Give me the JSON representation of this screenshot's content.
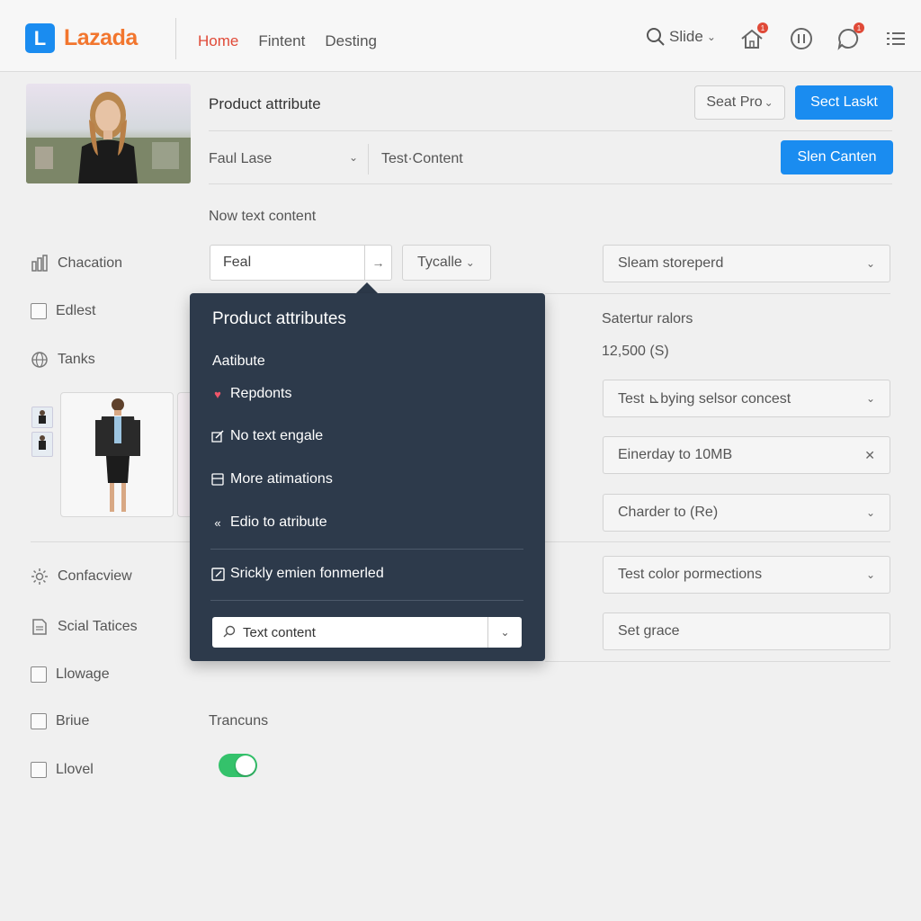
{
  "header": {
    "logo_letter": "L",
    "logo_text": "Lazada",
    "nav": [
      "Home",
      "Fintent",
      "Desting"
    ],
    "search_label": "Slide",
    "home_badge": "1",
    "chat_badge": "1"
  },
  "top_panel": {
    "title": "Product attribute",
    "outline_button": "Seat Pro",
    "primary_button": "Sect Laskt",
    "select_label": "Faul Lase",
    "select_text": "Test·Content",
    "secondary_primary_button": "Slen Canten",
    "section_label": "Now text content"
  },
  "inputs": {
    "feal_value": "Feal",
    "typecalle": "Tycalle",
    "sleam": "Sleam storeperd"
  },
  "sidebar": {
    "items": [
      {
        "label": "Chacation"
      },
      {
        "label": "Edlest"
      },
      {
        "label": "Tanks"
      },
      {
        "label": "Confacview"
      },
      {
        "label": "Scial Tatices"
      },
      {
        "label": "Llowage"
      },
      {
        "label": "Briue"
      },
      {
        "label": "Llovel"
      }
    ]
  },
  "popup": {
    "title": "Product attributes",
    "subtitle": "Aatibute",
    "items": [
      {
        "label": "Repdonts"
      },
      {
        "label": "No text engale"
      },
      {
        "label": "More atimations"
      },
      {
        "label": "Edio to atribute"
      },
      {
        "label": "Srickly emien fonmerled"
      }
    ],
    "search_value": "Text content"
  },
  "right_column": {
    "label": "Satertur ralors",
    "value": "12,500 (S)",
    "selects": [
      {
        "value": "Test ⊾bying selsor concest"
      },
      {
        "value": "Einerday to 10MB"
      },
      {
        "value": "Charder to (Re)"
      },
      {
        "value": "Test color pormections"
      }
    ],
    "grace_input": "Set grace"
  },
  "bottom": {
    "label": "Trancuns",
    "toggle_on": true
  },
  "colors": {
    "accent": "#1a8cf0",
    "brand": "#f2762e",
    "active_nav": "#e04a38",
    "popup_bg": "#2d3a4b",
    "toggle_on": "#34c26b"
  }
}
